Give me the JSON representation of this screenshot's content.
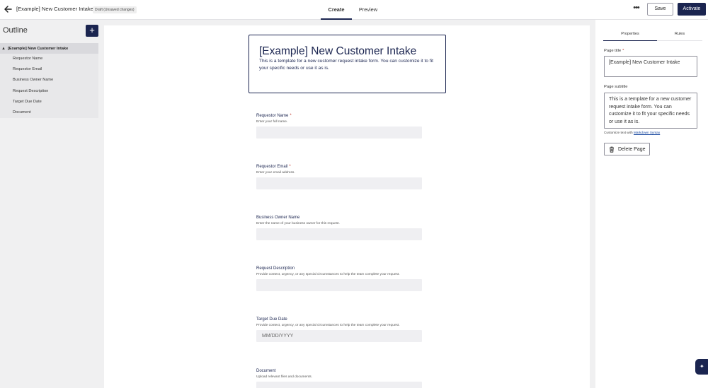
{
  "topbar": {
    "app_title": "[Example] New Customer Intake",
    "draft_badge": "Draft (Unsaved changes)",
    "tabs": [
      {
        "label": "Create",
        "active": true
      },
      {
        "label": "Preview",
        "active": false
      }
    ],
    "more_label": "•••",
    "save_label": "Save",
    "activate_label": "Activate"
  },
  "outline": {
    "heading": "Outline",
    "add_label": "+",
    "root": "[Example] New Customer Intake",
    "items": [
      "Requestor Name",
      "Requestor Email",
      "Business Owner Name",
      "Request Description",
      "Target Due Date",
      "Document"
    ]
  },
  "canvas": {
    "title": "[Example] New Customer Intake",
    "subtitle": "This is a template for a new customer request intake form. You can customize it to fit your specific needs or use it as is.",
    "fields": [
      {
        "label": "Requestor Name",
        "required": true,
        "help": "Enter your full name.",
        "value": ""
      },
      {
        "label": "Requestor Email",
        "required": true,
        "help": "Enter your email address.",
        "value": ""
      },
      {
        "label": "Business Owner Name",
        "required": false,
        "help": "Enter the name of your business owner for this request.",
        "value": ""
      },
      {
        "label": "Request Description",
        "required": false,
        "help": "Provide context, urgency, or any special circumstances to help the team complete your request.",
        "value": ""
      },
      {
        "label": "Target Due Date",
        "required": false,
        "help": "Provide context, urgency, or any special circumstances to help the team complete your request.",
        "value": "MM/DD/YYYY"
      },
      {
        "label": "Document",
        "required": false,
        "help": "Upload relevant files and documents.",
        "value": ""
      }
    ]
  },
  "properties": {
    "tabs": [
      "Properties",
      "Rules"
    ],
    "page_title_label": "Page title",
    "page_title_value": "[Example] New Customer Intake",
    "page_subtitle_label": "Page subtitle",
    "page_subtitle_value": "This is a template for a new customer request intake form. You can customize it to fit your specific needs or use it as is.",
    "hint_prefix": "Customize text with",
    "hint_link": "Markdown Syntax",
    "delete_label": "Delete Page"
  },
  "required_marker": "*",
  "fab_label": "✦",
  "colors": {
    "brand": "#1b2550",
    "required": "#c0392b",
    "link": "#1b4aa0"
  }
}
